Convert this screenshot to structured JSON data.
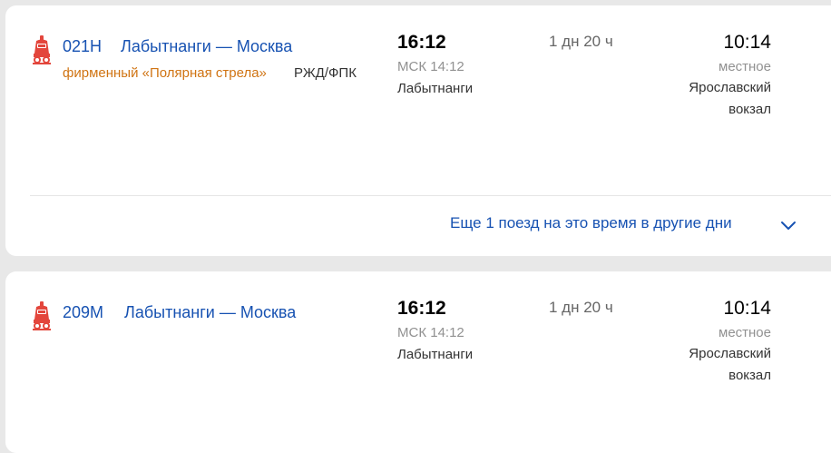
{
  "trains": [
    {
      "number": "021Н",
      "route": "Лабытнанги — Москва",
      "brand": "фирменный «Полярная стрела»",
      "carrier": "РЖД/ФПК",
      "departure": {
        "time": "16:12",
        "msk_time": "МСК 14:12",
        "station": "Лабытнанги"
      },
      "duration": "1 дн 20 ч",
      "arrival": {
        "time": "10:14",
        "time_note": "местное",
        "station_line1": "Ярославский",
        "station_line2": "вокзал"
      },
      "more_link": "Еще 1 поезд на это время в другие дни"
    },
    {
      "number": "209М",
      "route": "Лабытнанги — Москва",
      "departure": {
        "time": "16:12",
        "msk_time": "МСК 14:12",
        "station": "Лабытнанги"
      },
      "duration": "1 дн 20 ч",
      "arrival": {
        "time": "10:14",
        "time_note": "местное",
        "station_line1": "Ярославский",
        "station_line2": "вокзал"
      }
    }
  ],
  "icons": {
    "train": "train-icon",
    "expand": "chevron-down-icon"
  },
  "colors": {
    "link": "#1752b2",
    "brand": "#d07413",
    "train_icon": "#e3463c"
  }
}
